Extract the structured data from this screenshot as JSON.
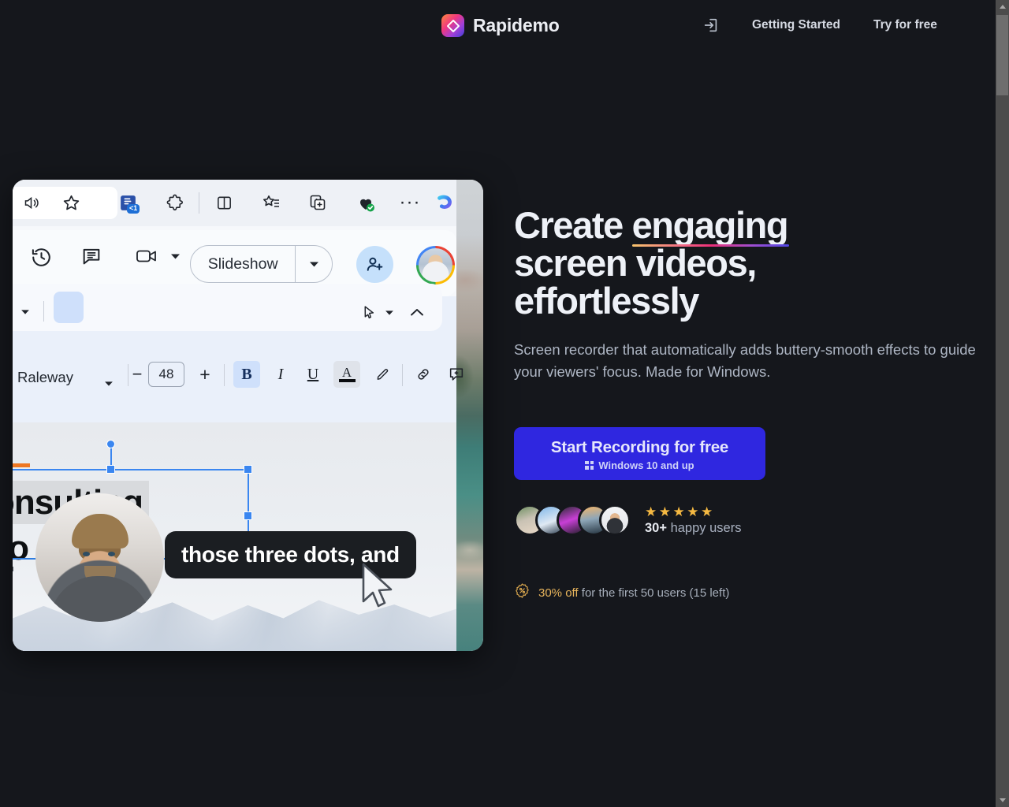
{
  "header": {
    "brand_name": "Rapidemo",
    "login_icon": "login-arrow-icon",
    "nav": [
      {
        "label": "Getting Started"
      },
      {
        "label": "Try for free"
      }
    ]
  },
  "hero": {
    "headline_part1": "Create ",
    "headline_underlined": "engaging",
    "headline_part2": "screen videos,",
    "headline_part3": "effortlessly",
    "subtitle": "Screen recorder that automatically adds buttery-smooth effects to guide your viewers' focus. Made for Windows.",
    "cta": {
      "main_label": "Start Recording for free",
      "sub_label": "Windows 10 and up",
      "icon": "windows-logo-icon",
      "color": "#2f27e0"
    },
    "social_proof": {
      "stars": "★★★★★",
      "star_count": 5,
      "star_color": "#f5b942",
      "count": "30+",
      "count_suffix": " happy users",
      "avatar_count": 5
    },
    "promo": {
      "icon": "discount-badge-icon",
      "highlight": "30% off",
      "rest": " for the first 50 users (15 left)",
      "highlight_color": "#e8b55c"
    }
  },
  "demo": {
    "browser_toolbar": {
      "icons": [
        {
          "name": "read-aloud-icon"
        },
        {
          "name": "favorite-star-icon"
        },
        {
          "name": "immersive-reader-icon",
          "badge": "<1"
        },
        {
          "name": "extensions-puzzle-icon"
        },
        {
          "name": "split-screen-icon"
        },
        {
          "name": "collections-icon"
        },
        {
          "name": "browser-essentials-icon"
        },
        {
          "name": "more-options-icon"
        },
        {
          "name": "copilot-icon"
        }
      ]
    },
    "docs_actions": {
      "history_icon": "version-history-icon",
      "comment_icon": "comment-icon",
      "meet_icon": "video-camera-icon",
      "slideshow_label": "Slideshow",
      "share_icon": "add-person-icon",
      "avatar": "google-account-avatar"
    },
    "format_toolbar": {
      "kebab_icon": "more-vertical-icon",
      "pointer_icon": "pointer-tool-icon",
      "collapse_icon": "chevron-up-icon",
      "font_family": "Raleway",
      "font_family_caret": "chevron-down-icon",
      "decrease_label": "−",
      "font_size": "48",
      "increase_label": "+",
      "bold_label": "B",
      "bold_active": true,
      "italic_label": "I",
      "underline_label": "U",
      "text_color_label": "A",
      "highlight_icon": "highlight-pen-icon",
      "link_icon": "insert-link-icon",
      "comment_add_icon": "add-comment-icon"
    },
    "slide": {
      "heading_text": "onsulting",
      "sub_text": "ro",
      "tiny_text": "psu",
      "caption": "those three dots, and",
      "selection": "selected-text-box",
      "webcam": "webcam-bubble"
    }
  },
  "scrollbar": {
    "up_icon": "scroll-up-arrow",
    "down_icon": "scroll-down-arrow"
  }
}
